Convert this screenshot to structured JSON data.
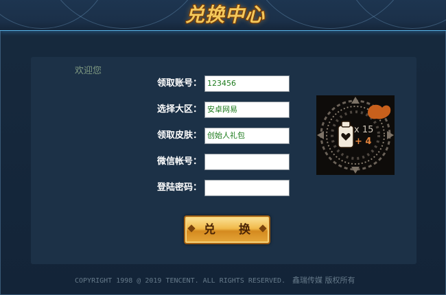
{
  "header": {
    "title": "兑换中心"
  },
  "form": {
    "welcome": "欢迎您",
    "fields": [
      {
        "label": "领取账号：",
        "value": "123456"
      },
      {
        "label": "选择大区：",
        "value": "安卓网易"
      },
      {
        "label": "领取皮肤：",
        "value": "创始人礼包"
      },
      {
        "label": "微信帐号：",
        "value": ""
      },
      {
        "label": "登陆密码：",
        "value": ""
      }
    ],
    "submit_label": "兑 换"
  },
  "item": {
    "icon": "gift-pack-icon",
    "count_text": "x 15",
    "bonus_text": "+ 4",
    "accent_color": "#c8601c"
  },
  "footer": {
    "copyright": "COPYRIGHT 1998 @ 2019 TENCENT. ALL RIGHTS RESERVED.",
    "company": "鑫瑞传媒 版权所有"
  }
}
